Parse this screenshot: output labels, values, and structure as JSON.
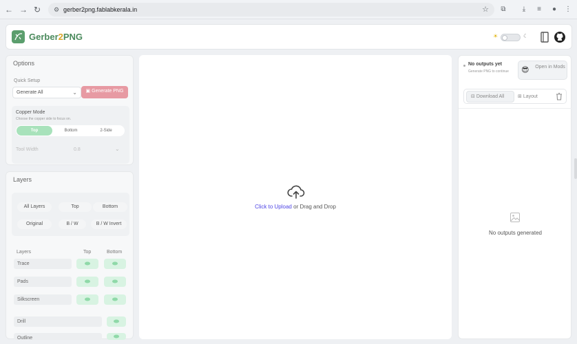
{
  "browser": {
    "url": "gerber2png.fablabkerala.in"
  },
  "brand": {
    "name_part1": "Gerber",
    "name_part2": "2",
    "name_part3": "PNG",
    "color": "#4a8a5c",
    "accent": "#d9a62b"
  },
  "options": {
    "title": "Options",
    "quick_setup_label": "Quick Setup",
    "quick_setup_value": "Generate All",
    "generate_button": "Generate PNG",
    "copper_mode": {
      "title": "Copper Mode",
      "description": "Choose the copper side to focus on.",
      "options": [
        "Top",
        "Bottom",
        "2-Side"
      ],
      "selected": "Top"
    },
    "tool_width_label": "Tool Width",
    "tool_width_value": "0.8"
  },
  "layers": {
    "title": "Layers",
    "side_options": [
      "All Layers",
      "Top",
      "Bottom"
    ],
    "color_options": [
      "Original",
      "B / W",
      "B / W Invert"
    ],
    "table_header": {
      "name": "Layers",
      "top": "Top",
      "bottom": "Bottom"
    },
    "rows": [
      "Trace",
      "Pads",
      "Silkscreen",
      "Drill",
      "Outline"
    ]
  },
  "upload": {
    "link_text": "Click to Upload",
    "rest_text": " or Drag and Drop"
  },
  "outputs": {
    "status_title": "No outputs yet",
    "status_subtitle": "Generate PNG to continue",
    "mods_button": "Open in Mods",
    "mods_emoji": "😎",
    "download_all": "Download All",
    "layout": "Layout",
    "empty_message": "No outputs generated"
  }
}
